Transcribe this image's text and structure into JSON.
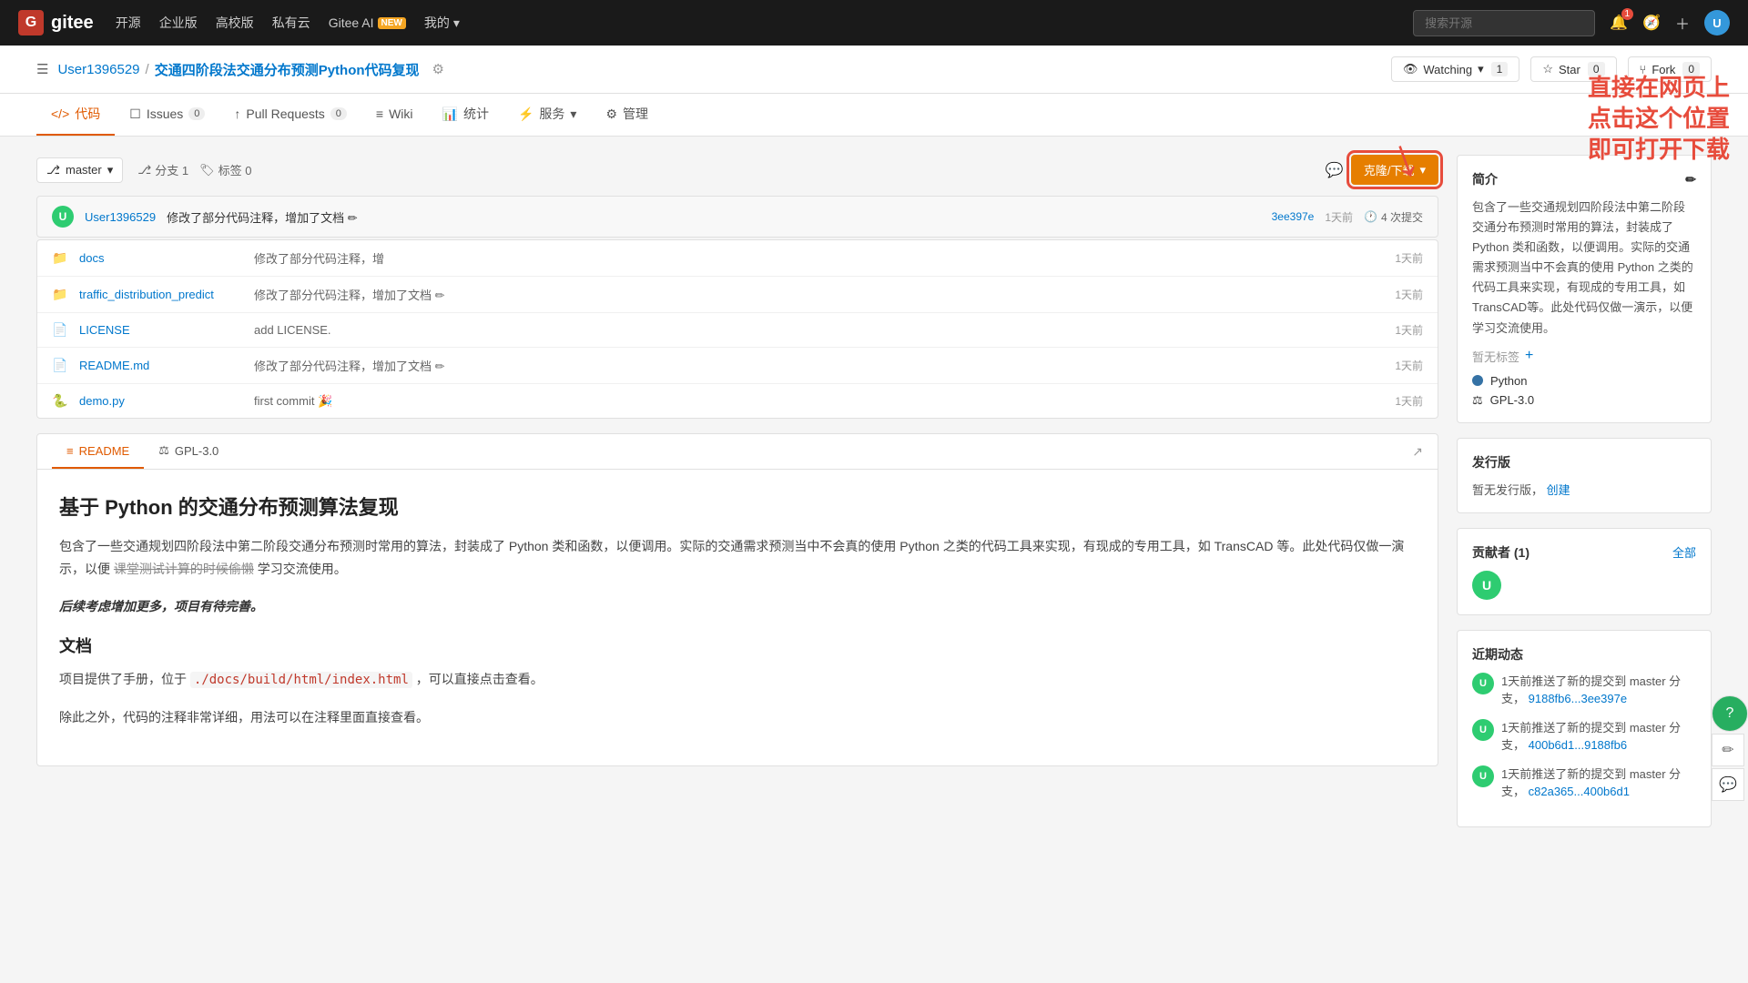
{
  "topnav": {
    "logo": "G",
    "logo_name": "gitee",
    "links": [
      "开源",
      "企业版",
      "高校版",
      "私有云"
    ],
    "gitee_ai": "Gitee AI",
    "new_badge": "NEW",
    "my": "我的",
    "search_placeholder": "搜索开源",
    "notif_count": "1"
  },
  "repo": {
    "breadcrumb_icon": "☰",
    "user": "User1396529",
    "separator": "/",
    "name": "交通四阶段法交通分布预测Python代码复现",
    "settings_icon": "⚙",
    "watch_label": "Watching",
    "watch_count": "1",
    "star_label": "Star",
    "star_count": "0",
    "fork_label": "Fork",
    "fork_count": "0"
  },
  "tabs": [
    {
      "label": "代码",
      "icon": "</>",
      "active": true,
      "badge": ""
    },
    {
      "label": "Issues",
      "icon": "☐",
      "active": false,
      "badge": "0"
    },
    {
      "label": "Pull Requests",
      "icon": "↑",
      "active": false,
      "badge": "0"
    },
    {
      "label": "Wiki",
      "icon": "≡",
      "active": false,
      "badge": ""
    },
    {
      "label": "统计",
      "icon": "📊",
      "active": false,
      "badge": ""
    },
    {
      "label": "服务",
      "icon": "⚡",
      "active": false,
      "badge": ""
    },
    {
      "label": "管理",
      "icon": "⚙",
      "active": false,
      "badge": ""
    }
  ],
  "branch": {
    "name": "master",
    "branches": "分支 1",
    "tags": "标签 0"
  },
  "clone_btn": "克隆/下载",
  "annotation": {
    "line1": "直接在网页上",
    "line2": "点击这个位置",
    "line3": "即可打开下载"
  },
  "commit": {
    "avatar": "U",
    "author": "User1396529",
    "message": "修改了部分代码注释，增加了文档",
    "edit_icon": "✏",
    "hash": "3ee397e",
    "time": "1天前",
    "count_icon": "⏱",
    "commit_count": "4 次提交"
  },
  "files": [
    {
      "icon": "📁",
      "name": "docs",
      "commit": "修改了部分代码注释，增",
      "time": "1天前",
      "type": "folder"
    },
    {
      "icon": "📁",
      "name": "traffic_distribution_predict",
      "commit": "修改了部分代码注释，增加了文档",
      "time": "1天前",
      "type": "folder"
    },
    {
      "icon": "📄",
      "name": "LICENSE",
      "commit": "add LICENSE.",
      "time": "1天前",
      "type": "file"
    },
    {
      "icon": "📄",
      "name": "README.md",
      "commit": "修改了部分代码注释，增加了文档",
      "time": "1天前",
      "type": "file"
    },
    {
      "icon": "🐍",
      "name": "demo.py",
      "commit": "first commit 🎉",
      "time": "1天前",
      "type": "file"
    }
  ],
  "readme": {
    "tabs": [
      {
        "label": "README",
        "icon": "≡",
        "active": true
      },
      {
        "label": "GPL-3.0",
        "icon": "⚖",
        "active": false
      }
    ],
    "title": "基于 Python 的交通分布预测算法复现",
    "para1": "包含了一些交通规划四阶段法中第二阶段交通分布预测时常用的算法，封装成了 Python 类和函数，以便调用。实际的交通需求预测当中不会真的使用 Python 之类的代码工具来实现，有现成的专用工具，如 TransCAD 等。此处代码仅做一演示，以便 课堂测试计算的时候偷懒 学习交流使用。",
    "para2": "后续考虑增加更多，项目有待完善。",
    "doc_title": "文档",
    "doc_para": "项目提供了手册，位于 ./docs/build/html/index.html ，可以直接点击查看。",
    "doc_para2": "除此之外，代码的注释非常详细，用法可以在注释里面直接查看。"
  },
  "sidebar": {
    "intro_title": "简介",
    "intro_edit": "✏",
    "intro_desc": "包含了一些交通规划四阶段法中第二阶段交通分布预测时常用的算法，封装成了 Python 类和函数，以便调用。实际的交通需求预测当中不会真的使用 Python 之类的代码工具来实现，有现成的专用工具，如 TransCAD等。此处代码仅做一演示，以便学习交流使用。",
    "no_tag": "暂无标签",
    "add_icon": "+",
    "lang_name": "Python",
    "license_name": "GPL-3.0",
    "release_title": "发行版",
    "no_release": "暂无发行版，",
    "create_link": "创建",
    "contributors_title": "贡献者 (1)",
    "all_link": "全部",
    "activity_title": "近期动态",
    "activities": [
      {
        "text": "1天前推送了新的提交到 master 分支，",
        "link": "9188fb6...3ee397e"
      },
      {
        "text": "1天前推送了新的提交到 master 分支，",
        "link": "400b6d1...9188fb6"
      },
      {
        "text": "1天前推送了新的提交到 master 分支，",
        "link": "c82a365...400b6d1"
      }
    ]
  }
}
